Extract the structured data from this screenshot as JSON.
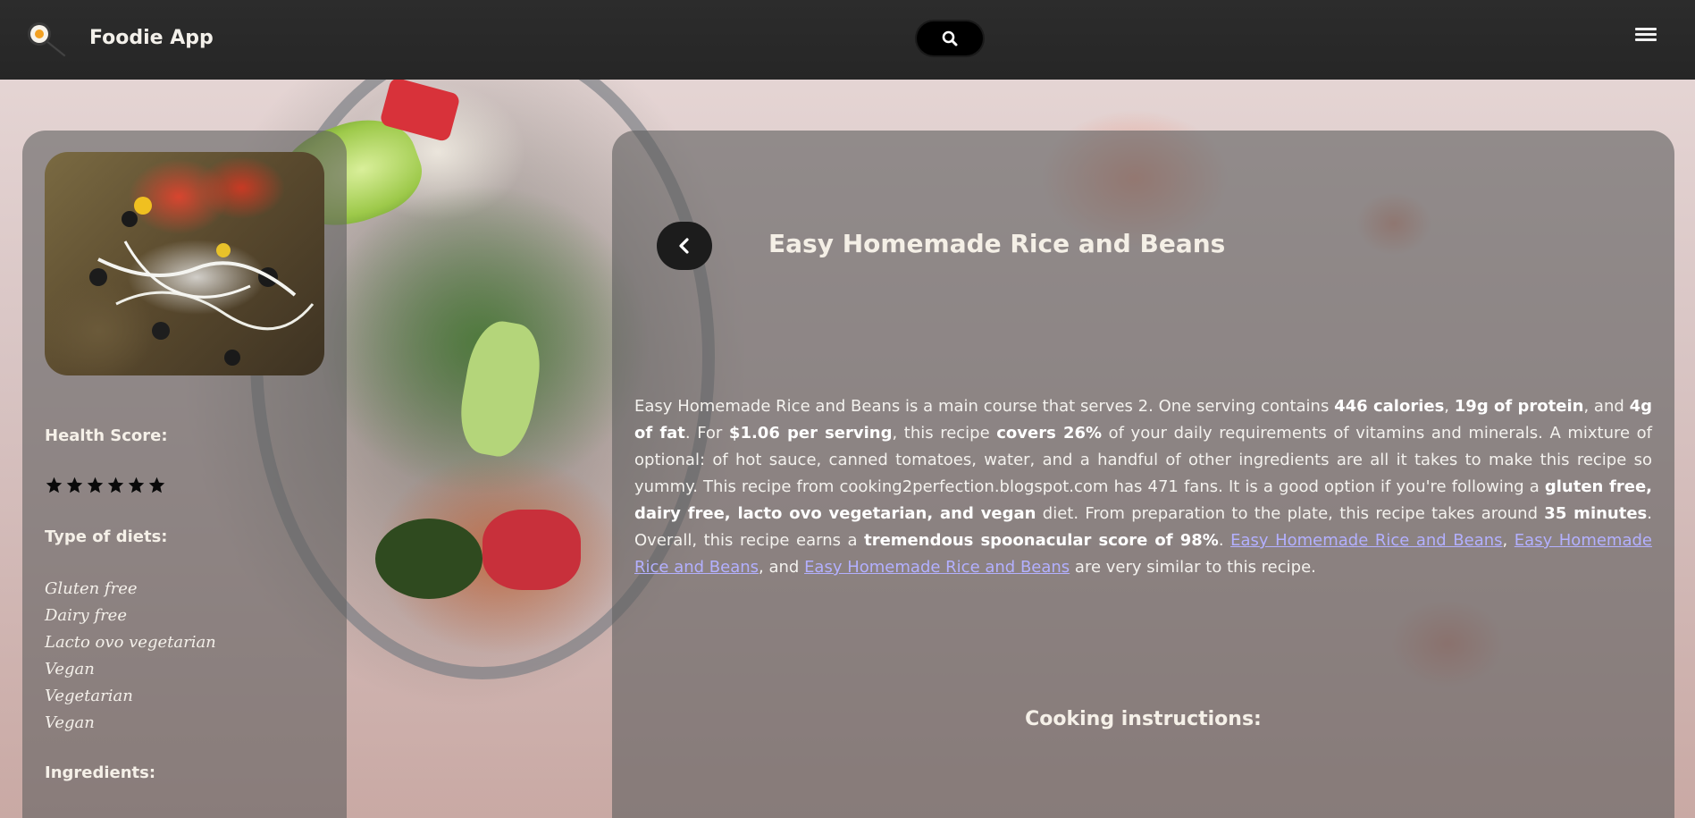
{
  "header": {
    "app_title": "Foodie App",
    "logo_icon": "frying-pan-egg-icon",
    "search_icon": "search-icon",
    "menu_icon": "hamburger-menu-icon"
  },
  "sidebar": {
    "health_score_label": "Health Score:",
    "health_score_stars": 6,
    "diets_label": "Type of diets:",
    "diets": [
      "Gluten free",
      "Dairy free",
      "Lacto ovo vegetarian",
      "Vegan",
      "Vegetarian",
      "Vegan"
    ],
    "ingredients_label": "Ingredients:"
  },
  "main": {
    "back_icon": "chevron-left-icon",
    "title": "Easy Homemade Rice and Beans",
    "summary": {
      "t1": "Easy Homemade Rice and Beans is a main course that serves 2. One serving contains ",
      "b1": "446 calories",
      "t2": ", ",
      "b2": "19g of protein",
      "t3": ", and ",
      "b3": "4g of fat",
      "t4": ". For ",
      "b4": "$1.06 per serving",
      "t5": ", this recipe ",
      "b5": "covers 26%",
      "t6": " of your daily requirements of vitamins and minerals. A mixture of optional: of hot sauce, canned tomatoes, water, and a handful of other ingredients are all it takes to make this recipe so yummy. This recipe from cooking2perfection.blogspot.com has 471 fans. It is a good option if you're following a ",
      "b6": "gluten free, dairy free, lacto ovo vegetarian, and vegan",
      "t7": " diet. From preparation to the plate, this recipe takes around ",
      "b7": "35 minutes",
      "t8": ". Overall, this recipe earns a ",
      "b8": "tremendous spoonacular score of 98%",
      "t9": ". ",
      "link1": "Easy Homemade Rice and Beans",
      "t10": ", ",
      "link2": "Easy Homemade Rice and Beans",
      "t11": ", and ",
      "link3": "Easy Homemade Rice and Beans",
      "t12": " are very similar to this recipe."
    },
    "cooking_label": "Cooking instructions:"
  },
  "colors": {
    "header_bg": "#2a2a2a",
    "card_bg": "rgba(95,95,95,0.6)",
    "link": "#b3b0ff"
  }
}
